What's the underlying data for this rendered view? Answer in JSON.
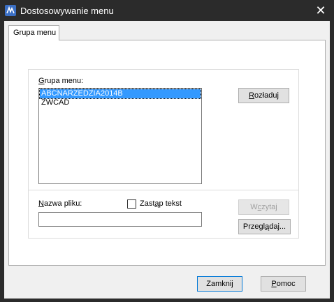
{
  "window": {
    "title": "Dostosowywanie menu",
    "close_icon": "close-icon",
    "app_icon": "zwcad-app-icon"
  },
  "tabs": [
    {
      "label": "Grupa menu",
      "selected": true
    }
  ],
  "panel": {
    "group_label_key": "G",
    "group_label_rest": "rupa menu:",
    "menu_groups": [
      {
        "label": "ABCNARZEDZIA2014B",
        "selected": true
      },
      {
        "label": "ZWCAD",
        "selected": false
      }
    ],
    "unload_button": {
      "key": "R",
      "rest": "ozładuj"
    },
    "file_name_label_key": "N",
    "file_name_label_rest": "azwa pliku:",
    "file_name_value": "",
    "replace_text": {
      "pre": "Zast",
      "key": "ą",
      "post": "p tekst",
      "checked": false
    },
    "load_button": {
      "pre": "W",
      "key": "c",
      "post": "zytaj",
      "enabled": false
    },
    "browse_button": {
      "pre": "Przegl",
      "key": "ą",
      "post": "daj..."
    }
  },
  "footer": {
    "close_button": {
      "pre": "Zamkni",
      "key": "j",
      "post": ""
    },
    "help_button": {
      "pre": "",
      "key": "P",
      "post": "omoc"
    }
  },
  "colors": {
    "titlebar": "#2b2b2b",
    "selection": "#3399ff",
    "accent_border": "#0078d7"
  }
}
